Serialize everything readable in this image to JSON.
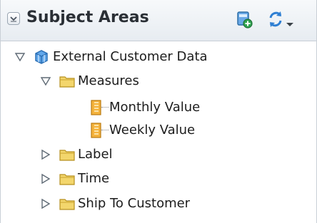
{
  "panel": {
    "title": "Subject Areas",
    "collapse_icon": "chevron-down-icon",
    "new_icon": "create-subject-area-icon",
    "refresh_icon": "refresh-icon",
    "menu_icon": "dropdown-arrow-icon"
  },
  "tree": {
    "root": {
      "label": "External Customer Data",
      "icon": "cube-icon",
      "expanded": true
    },
    "measures": {
      "label": "Measures",
      "icon": "folder-icon",
      "expanded": true,
      "items": [
        {
          "label": "Monthly Value",
          "icon": "measure-column-icon"
        },
        {
          "label": "Weekly Value",
          "icon": "measure-column-icon"
        }
      ]
    },
    "folders": [
      {
        "label": "Label",
        "icon": "folder-icon",
        "expanded": false
      },
      {
        "label": "Time",
        "icon": "folder-icon",
        "expanded": false
      },
      {
        "label": "Ship To Customer",
        "icon": "folder-icon",
        "expanded": false
      }
    ]
  },
  "colors": {
    "header_gradient_top": "#f7f9fb",
    "header_gradient_bottom": "#e7ecf1",
    "folder": "#f0cf55",
    "cube": "#3f8fd6",
    "measure": "#f4b23c"
  }
}
